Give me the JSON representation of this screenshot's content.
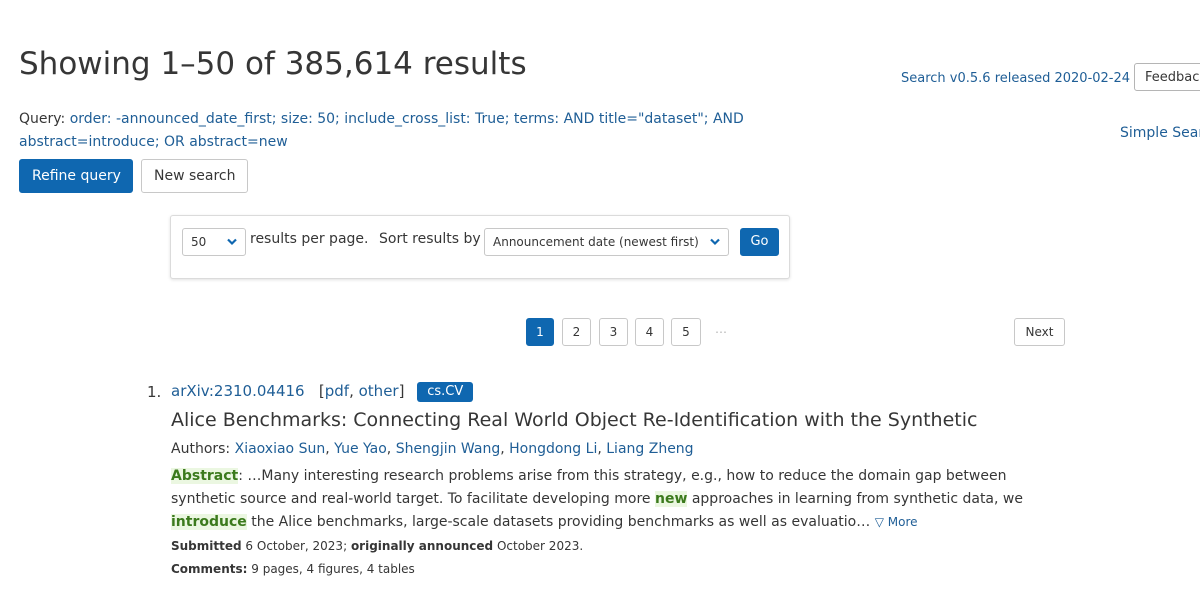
{
  "header": {
    "title": "Showing 1–50 of 385,614 results",
    "release_link": "Search v0.5.6 released 2020-02-24",
    "feedback_label": "Feedback?",
    "simple_search_link": "Simple Search"
  },
  "query": {
    "label": "Query:",
    "value": "order: -announced_date_first; size: 50; include_cross_list: True; terms: AND title=\"dataset\"; AND abstract=introduce; OR abstract=new"
  },
  "actions": {
    "refine_label": "Refine query",
    "new_search_label": "New search"
  },
  "controls": {
    "per_page_value": "50",
    "per_page_label": "results per page.",
    "sort_label": "Sort results by",
    "sort_value": "Announcement date (newest first)",
    "go_label": "Go"
  },
  "pagination": {
    "pages": [
      "1",
      "2",
      "3",
      "4",
      "5"
    ],
    "current_page": 1,
    "ellipsis": "…",
    "next_label": "Next"
  },
  "results": [
    {
      "number": "1.",
      "arxiv_id": "arXiv:2310.04416",
      "pdf_label": "pdf",
      "other_label": "other",
      "category": "cs.CV",
      "title": "Alice Benchmarks: Connecting Real World Object Re-Identification with the Synthetic",
      "authors_label": "Authors:",
      "authors": [
        "Xiaoxiao Sun",
        "Yue Yao",
        "Shengjin Wang",
        "Hongdong Li",
        "Liang Zheng"
      ],
      "abstract_label": "Abstract",
      "abstract_part1": ": …Many interesting research problems arise from this strategy, e.g., how to reduce the domain gap between synthetic source and real-world target. To facilitate developing more ",
      "abstract_hl1": "new",
      "abstract_part2": " approaches in learning from synthetic data, we ",
      "abstract_hl2": "introduce",
      "abstract_part3": " the Alice benchmarks, large-scale datasets providing benchmarks as well as evaluatio…",
      "more_label": "▽ More",
      "submitted_label": "Submitted",
      "submitted_value": "6 October, 2023;",
      "announced_label": "originally announced",
      "announced_value": "October 2023.",
      "comments_label": "Comments:",
      "comments_value": "9 pages, 4 figures, 4 tables"
    }
  ],
  "colors": {
    "primary": "#0f67b0",
    "link": "#1f5e96",
    "highlight_bg": "#ebf7e1",
    "highlight_fg": "#3b7a1c"
  }
}
